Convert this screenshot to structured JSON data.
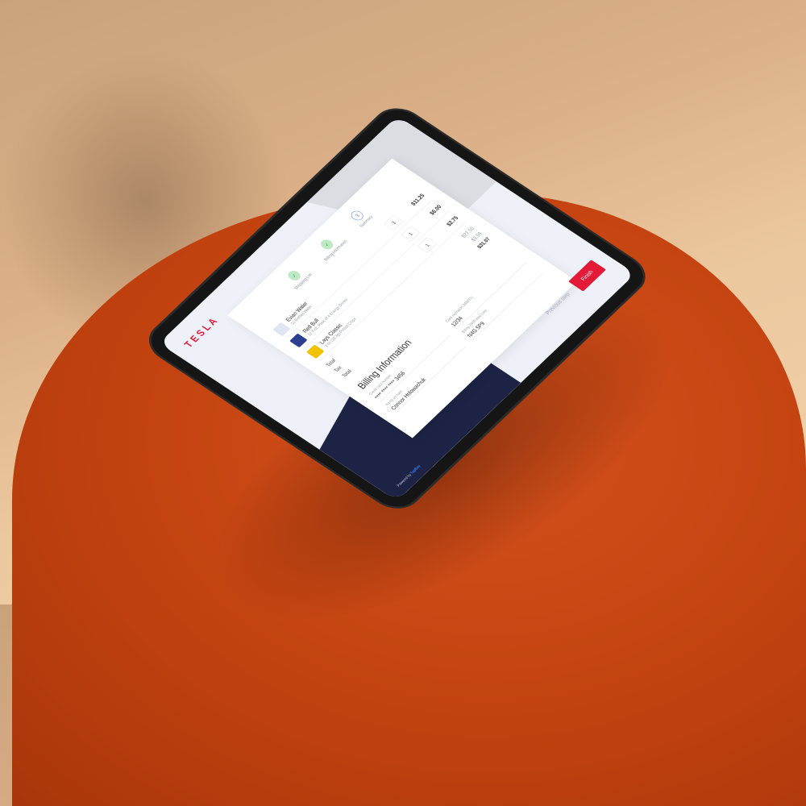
{
  "brand": "TESLA",
  "steps": [
    {
      "label": "Shopping List",
      "icon": "check-icon",
      "state": "done"
    },
    {
      "label": "Billing Information",
      "icon": "check-icon",
      "state": "done"
    },
    {
      "label": "Summary",
      "icon": "number-icon",
      "num": "3",
      "state": "current"
    }
  ],
  "items": [
    {
      "name": "Evian Water",
      "desc": "1L Bottled Water",
      "qty": "3",
      "price": "$11.25",
      "color": "#dfe6f2"
    },
    {
      "name": "Red Bull",
      "desc": "12 fl oz, Pack of 4 Energy Drinks",
      "qty": "1",
      "price": "$6.00",
      "color": "#2a3f8f"
    },
    {
      "name": "Lays Classic",
      "desc": "1 oz (28.3g) Potato Chips",
      "qty": "1",
      "price": "$2.75",
      "color": "#f2c200"
    }
  ],
  "totals": [
    {
      "label": "Total",
      "value": "$27.50"
    },
    {
      "label": "Tax",
      "value": "$3.58"
    },
    {
      "label": "Total",
      "value": "$31.07"
    }
  ],
  "billing": {
    "title": "Billing Information",
    "card_label": "Credit card number",
    "card_value": "**** **** **** 3456",
    "exp_label": "Card expiration (MM/YY)",
    "exp_value": "12/34",
    "name_label": "Name on card",
    "name_value": "Connor Holowachuk",
    "zip_label": "Billing ZIP/Postal code",
    "zip_value": "N4G 5P9"
  },
  "actions": {
    "previous": "Previous step",
    "finish": "Finish"
  },
  "footer": {
    "prefix": "Powered by",
    "brand": "TapBuy"
  },
  "colors": {
    "accent": "#e31937",
    "navy": "#1c2344"
  }
}
